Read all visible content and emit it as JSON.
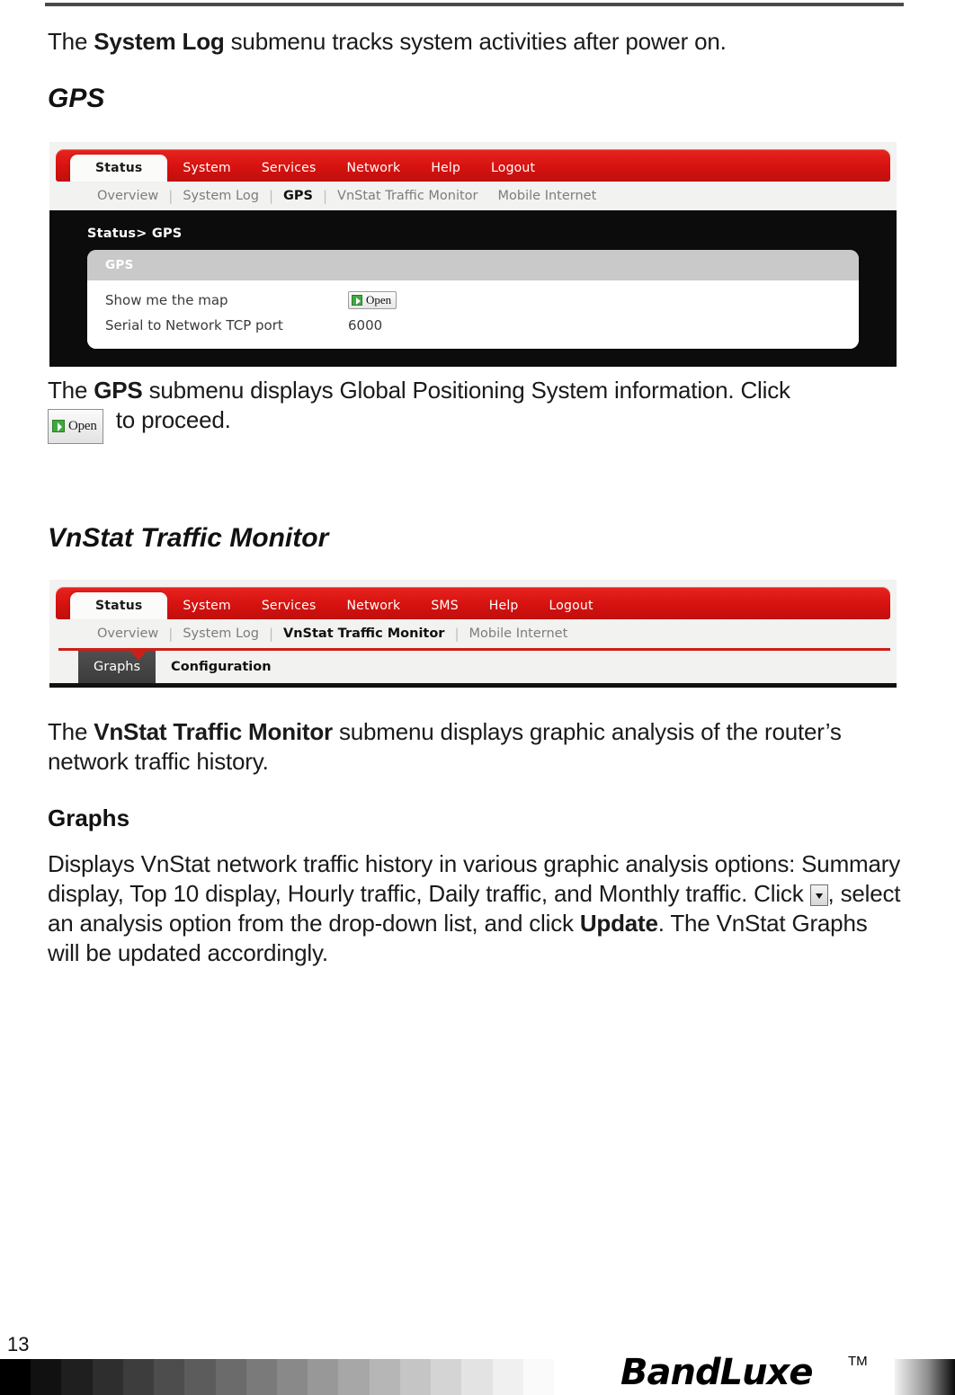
{
  "document": {
    "page_number": "13",
    "intro_paragraph_prefix": "The ",
    "intro_paragraph_bold": "System Log",
    "intro_paragraph_suffix": " submenu tracks system activities after power on."
  },
  "gps_section": {
    "heading": "GPS",
    "screenshot": {
      "main_tabs": [
        "Status",
        "System",
        "Services",
        "Network",
        "Help",
        "Logout"
      ],
      "active_main_tab": "Status",
      "sub_tabs": [
        "Overview",
        "System Log",
        "GPS",
        "VnStat Traffic Monitor",
        "Mobile Internet"
      ],
      "active_sub_tab": "GPS",
      "breadcrumb": "Status> GPS",
      "card_title": "GPS",
      "rows": [
        {
          "label": "Show me the map",
          "value": "",
          "control": "open-button",
          "control_label": "Open"
        },
        {
          "label": "Serial to Network TCP port",
          "value": "6000",
          "control": "",
          "control_label": ""
        }
      ]
    },
    "caption_prefix": "The ",
    "caption_bold": "GPS",
    "caption_mid": " submenu displays Global Positioning System information. Click",
    "caption_button_label": "Open",
    "caption_suffix": "to proceed."
  },
  "vnstat_section": {
    "heading": "VnStat Traffic Monitor",
    "screenshot": {
      "main_tabs": [
        "Status",
        "System",
        "Services",
        "Network",
        "SMS",
        "Help",
        "Logout"
      ],
      "active_main_tab": "Status",
      "sub_tabs": [
        "Overview",
        "System Log",
        "VnStat Traffic Monitor",
        "Mobile Internet"
      ],
      "active_sub_tab": "VnStat Traffic Monitor",
      "inner_tabs": [
        "Graphs",
        "Configuration"
      ],
      "active_inner_tab": "Graphs"
    },
    "caption_prefix": "The ",
    "caption_bold": "VnStat Traffic Monitor",
    "caption_suffix": " submenu displays graphic analysis of the router’s network traffic history.",
    "graphs_heading": "Graphs",
    "graphs_paragraph_part1": "Displays VnStat network traffic history in various graphic analysis options: Summary display, Top 10 display, Hourly traffic, Daily traffic, and Monthly traffic. Click ",
    "graphs_paragraph_part2": ", select an analysis option from the drop-down list, and click ",
    "graphs_paragraph_bold": "Update",
    "graphs_paragraph_part3": ". The VnStat Graphs will be updated accordingly."
  },
  "footer": {
    "logo_text": "BandLuxe",
    "logo_tm": "TM",
    "grayscale_steps": [
      "#000000",
      "#111111",
      "#1f1f1f",
      "#2e2e2e",
      "#3d3d3d",
      "#4d4d4d",
      "#5c5c5c",
      "#6b6b6b",
      "#7a7a7a",
      "#898989",
      "#989898",
      "#a7a7a7",
      "#b6b6b6",
      "#c5c5c5",
      "#d4d4d4",
      "#e3e3e3",
      "#f0f0f0",
      "#fafafa"
    ]
  },
  "colors": {
    "brand_red": "#d5120f",
    "accent_green": "#3fa93f",
    "panel_dark": "#0c0c0c"
  }
}
